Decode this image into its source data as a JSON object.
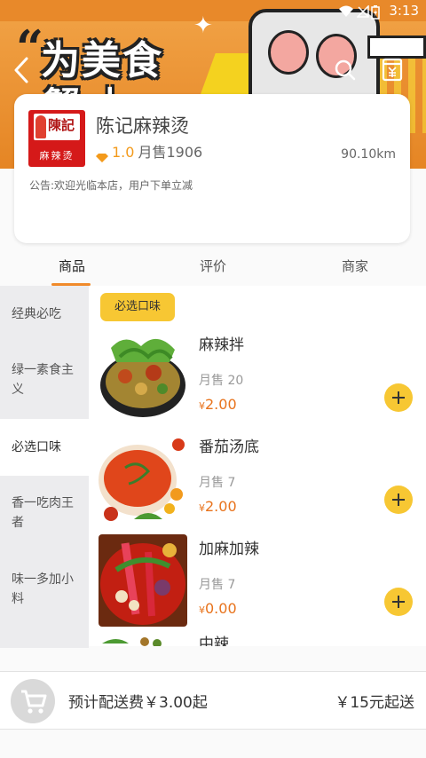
{
  "status_bar": {
    "time": "3:13"
  },
  "banner": {
    "quote_mark": "“",
    "title": "为美食",
    "subtitle": "蟹 土"
  },
  "store": {
    "name": "陈记麻辣烫",
    "logo_brand": "陳記",
    "logo_text": "麻辣烫",
    "rating": "1.0",
    "monthly_sales": "月售1906",
    "distance": "90.10km",
    "notice": "公告:欢迎光临本店，用户下单立减"
  },
  "tabs": [
    {
      "label": "商品",
      "active": true
    },
    {
      "label": "评价",
      "active": false
    },
    {
      "label": "商家",
      "active": false
    }
  ],
  "categories": [
    {
      "label": "经典必吃",
      "active": false
    },
    {
      "label": "绿一素食主义",
      "active": false
    },
    {
      "label": "必选口味",
      "active": true
    },
    {
      "label": "香一吃肉王者",
      "active": false
    },
    {
      "label": "味一多加小料",
      "active": false
    }
  ],
  "section": {
    "title": "必选口味"
  },
  "products": [
    {
      "name": "麻辣拌",
      "sold": "月售 20",
      "currency": "¥",
      "price": "2.00"
    },
    {
      "name": "番茄汤底",
      "sold": "月售 7",
      "currency": "¥",
      "price": "2.00"
    },
    {
      "name": "加麻加辣",
      "sold": "月售 7",
      "currency": "¥",
      "price": "0.00"
    },
    {
      "name": "中辣",
      "sold": "",
      "currency": "",
      "price": ""
    }
  ],
  "cart": {
    "delivery_fee": "预计配送费￥3.00起",
    "min_order": "￥15元起送"
  },
  "colors": {
    "accent_orange": "#f08a2a",
    "accent_yellow": "#f7c733",
    "price": "#e8731c",
    "logo_red": "#d51919"
  },
  "icons": [
    "back-arrow-icon",
    "search-icon",
    "bill-icon",
    "diamond-icon",
    "plus-icon",
    "shopping-cart-icon",
    "wifi-icon",
    "battery-icon"
  ]
}
